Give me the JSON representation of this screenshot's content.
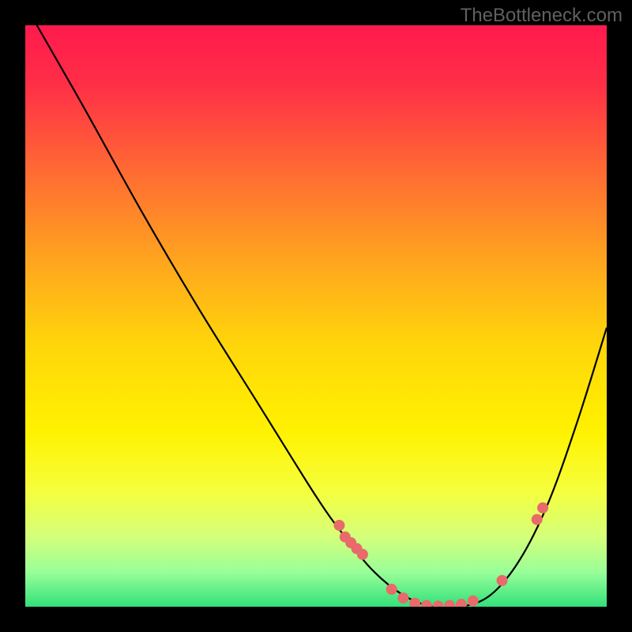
{
  "watermark": "TheBottleneck.com",
  "gradient": {
    "stops": [
      {
        "offset": 0.0,
        "color": "#ff1a4d"
      },
      {
        "offset": 0.1,
        "color": "#ff2e47"
      },
      {
        "offset": 0.25,
        "color": "#ff6a33"
      },
      {
        "offset": 0.4,
        "color": "#ffa31f"
      },
      {
        "offset": 0.55,
        "color": "#ffd60a"
      },
      {
        "offset": 0.7,
        "color": "#fff200"
      },
      {
        "offset": 0.8,
        "color": "#f5ff3d"
      },
      {
        "offset": 0.88,
        "color": "#d4ff7a"
      },
      {
        "offset": 0.94,
        "color": "#99ff99"
      },
      {
        "offset": 1.0,
        "color": "#33e07a"
      }
    ]
  },
  "chart_data": {
    "type": "line",
    "title": "",
    "xlabel": "",
    "ylabel": "",
    "xlim": [
      0,
      100
    ],
    "ylim": [
      0,
      100
    ],
    "series": [
      {
        "name": "curve",
        "x": [
          2,
          10,
          20,
          30,
          40,
          50,
          55,
          60,
          65,
          70,
          75,
          80,
          85,
          90,
          95,
          100
        ],
        "y": [
          100,
          86,
          68,
          51,
          35,
          19,
          12,
          6,
          2,
          0,
          0,
          2,
          8,
          18,
          32,
          48
        ]
      }
    ],
    "markers": {
      "name": "points",
      "x": [
        54,
        55,
        56,
        57,
        58,
        63,
        65,
        67,
        69,
        71,
        73,
        75,
        77,
        82,
        88,
        89
      ],
      "y": [
        14,
        12,
        11,
        10,
        9,
        3,
        1.5,
        0.6,
        0.2,
        0.1,
        0.2,
        0.4,
        1.0,
        4.5,
        15,
        17
      ]
    }
  },
  "style": {
    "curve_stroke": "#000000",
    "curve_width": 2.2,
    "marker_fill": "#e86a6a",
    "marker_radius": 7
  }
}
